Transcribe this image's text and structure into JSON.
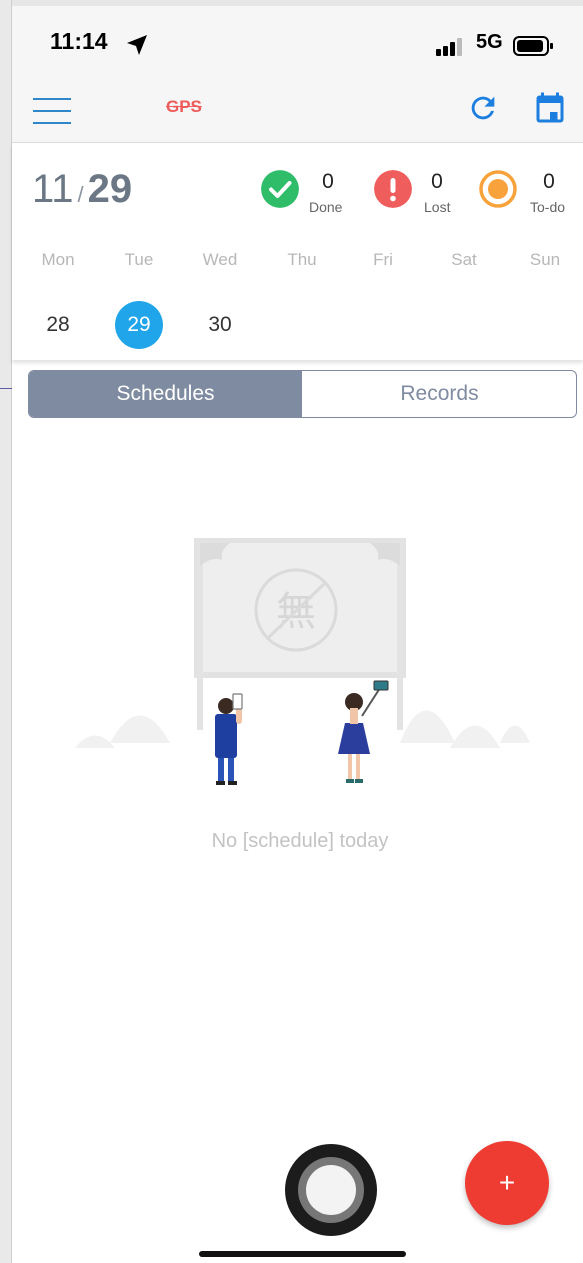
{
  "status_bar": {
    "time": "11:14",
    "network": "5G"
  },
  "header": {
    "title": "GPS"
  },
  "date": {
    "month": "11",
    "separator": "/",
    "day": "29"
  },
  "stats": [
    {
      "count": "0",
      "label": "Done",
      "color": "#2fbd6a",
      "icon": "check-circle-icon"
    },
    {
      "count": "0",
      "label": "Lost",
      "color": "#ef5d5d",
      "icon": "exclamation-circle-icon"
    },
    {
      "count": "0",
      "label": "To-do",
      "color": "#f7a23a",
      "icon": "target-circle-icon"
    }
  ],
  "week": {
    "days": [
      "Mon",
      "Tue",
      "Wed",
      "Thu",
      "Fri",
      "Sat",
      "Sun"
    ],
    "dates": [
      "28",
      "29",
      "30"
    ],
    "selected": "29"
  },
  "tabs": {
    "schedules": "Schedules",
    "records": "Records",
    "active": "Schedules"
  },
  "empty_state": {
    "message": "No [schedule] today",
    "stamp_character": "無"
  },
  "fab": {
    "label": "+"
  },
  "colors": {
    "accent": "#20a5ea",
    "tab": "#7f8ba1",
    "fab": "#ee3c33",
    "header_icon": "#1c7fe0"
  }
}
